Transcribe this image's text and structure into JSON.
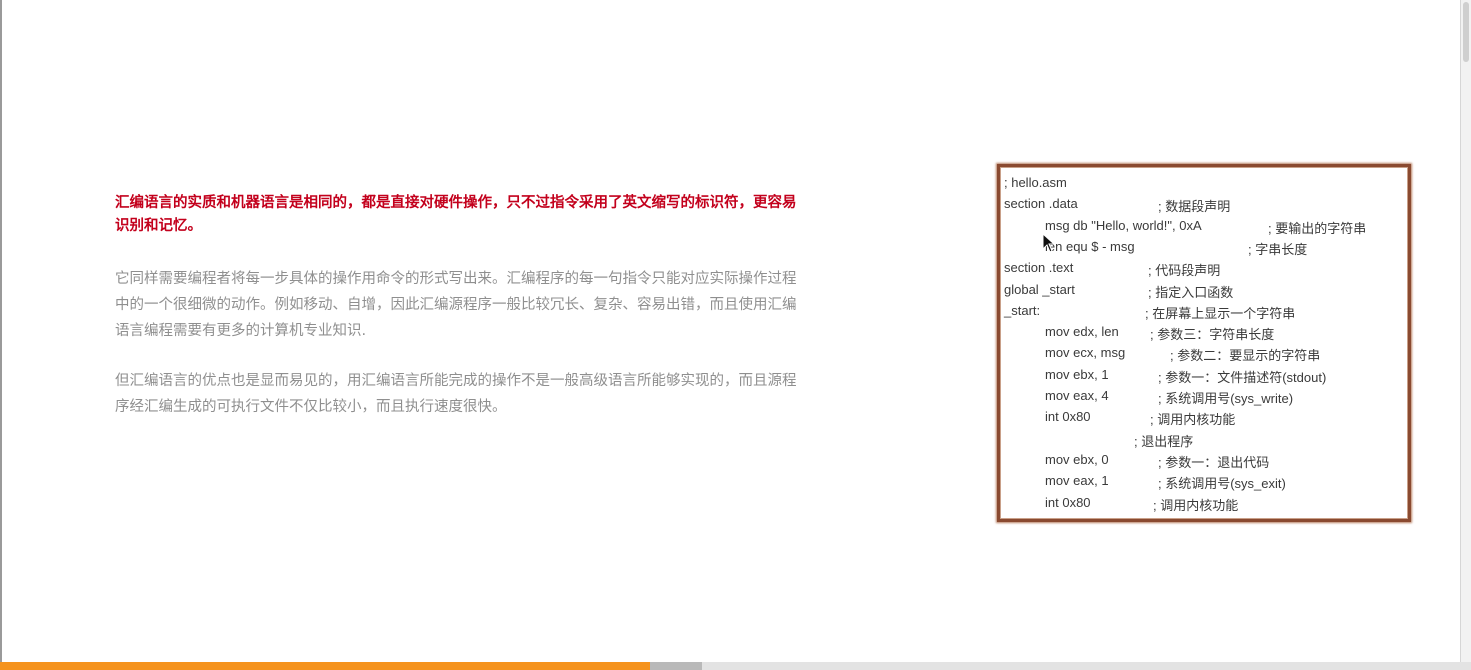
{
  "slide": {
    "highlight": "汇编语言的实质和机器语言是相同的，都是直接对硬件操作，只不过指令采用了英文缩写的标识符，更容易识别和记忆。",
    "para1": "它同样需要编程者将每一步具体的操作用命令的形式写出来。汇编程序的每一句指令只能对应实际操作过程中的一个很细微的动作。例如移动、自增，因此汇编源程序一般比较冗长、复杂、容易出错，而且使用汇编语言编程需要有更多的计算机专业知识.",
    "para2": "但汇编语言的优点也是显而易见的，用汇编语言所能完成的操作不是一般高级语言所能够实现的，而且源程序经汇编生成的可执行文件不仅比较小，而且执行速度很快。"
  },
  "code": {
    "lines": [
      {
        "code": "; hello.asm",
        "comment": ""
      },
      {
        "code": "section .data",
        "comment": "; 数据段声明"
      },
      {
        "code": "msg db \"Hello, world!\", 0xA",
        "comment": "; 要输出的字符串"
      },
      {
        "code": "len equ $ - msg",
        "comment": "; 字串长度"
      },
      {
        "code": "section .text",
        "comment": "; 代码段声明"
      },
      {
        "code": "global _start",
        "comment": "; 指定入口函数"
      },
      {
        "code": "_start:",
        "comment": "; 在屏幕上显示一个字符串"
      },
      {
        "code": "mov edx, len",
        "comment": "; 参数三：字符串长度"
      },
      {
        "code": "mov ecx, msg",
        "comment": "; 参数二：要显示的字符串"
      },
      {
        "code": "mov ebx, 1",
        "comment": "; 参数一：文件描述符(stdout)"
      },
      {
        "code": "mov eax, 4",
        "comment": "; 系统调用号(sys_write)"
      },
      {
        "code": "int 0x80",
        "comment": "; 调用内核功能"
      },
      {
        "code": "",
        "comment": "; 退出程序"
      },
      {
        "code": "mov ebx, 0",
        "comment": "; 参数一：退出代码"
      },
      {
        "code": "mov eax, 1",
        "comment": "; 系统调用号(sys_exit)"
      },
      {
        "code": "int 0x80",
        "comment": "; 调用内核功能"
      }
    ]
  },
  "player": {
    "progress_percent": 44.2,
    "buffered_percent": 47.7,
    "progress_color": "#f5931e"
  },
  "icons": {
    "cursor": "mouse-pointer-icon"
  }
}
